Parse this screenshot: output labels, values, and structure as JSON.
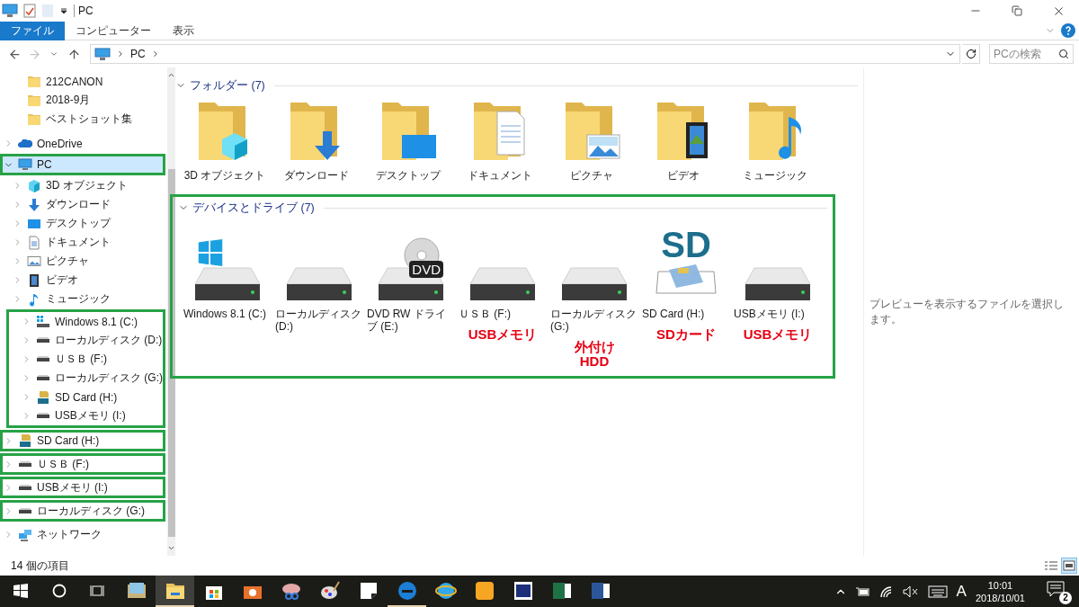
{
  "window": {
    "title": "PC"
  },
  "ribbon": {
    "tabs": [
      {
        "label": "ファイル",
        "selected": true
      },
      {
        "label": "コンピューター",
        "selected": false
      },
      {
        "label": "表示",
        "selected": false
      }
    ]
  },
  "address_bar": {
    "nav": [
      {
        "kind": "back",
        "disabled": false
      },
      {
        "kind": "forward",
        "disabled": true
      },
      {
        "kind": "recent",
        "disabled": false
      },
      {
        "kind": "up",
        "disabled": false
      }
    ],
    "path": [
      "PC"
    ],
    "search": {
      "placeholder": "PCの検索"
    }
  },
  "sidebar": {
    "quick_access_items": [
      {
        "label": "212CANON"
      },
      {
        "label": "2018-9月"
      },
      {
        "label": "ベストショット集"
      }
    ],
    "items": [
      {
        "kind": "cloud",
        "label": "OneDrive",
        "expanded": false,
        "selected": false,
        "framed": false
      },
      {
        "kind": "pc",
        "label": "PC",
        "expanded": true,
        "selected": true,
        "framed": true,
        "children": [
          {
            "kind": "cube",
            "label": "3D オブジェクト",
            "expanded": false,
            "selected": false,
            "framed": false
          },
          {
            "kind": "download",
            "label": "ダウンロード",
            "expanded": false,
            "selected": false,
            "framed": false
          },
          {
            "kind": "desktop",
            "label": "デスクトップ",
            "expanded": false,
            "selected": false,
            "framed": false
          },
          {
            "kind": "document",
            "label": "ドキュメント",
            "expanded": false,
            "selected": false,
            "framed": false
          },
          {
            "kind": "picture",
            "label": "ピクチャ",
            "expanded": false,
            "selected": false,
            "framed": false
          },
          {
            "kind": "video",
            "label": "ビデオ",
            "expanded": false,
            "selected": false,
            "framed": false
          },
          {
            "kind": "music",
            "label": "ミュージック",
            "expanded": false,
            "selected": false,
            "framed": false
          },
          {
            "kind": "frame",
            "items": [
              {
                "kind": "windows-drive",
                "label": "Windows 8.1 (C:)",
                "expanded": false,
                "selected": false,
                "framed": false
              },
              {
                "kind": "drive",
                "label": "ローカルディスク (D:)",
                "expanded": false,
                "selected": false,
                "framed": false
              },
              {
                "kind": "drive",
                "label": "ＵＳＢ (F:)",
                "expanded": false,
                "selected": false,
                "framed": false
              },
              {
                "kind": "drive",
                "label": "ローカルディスク (G:)",
                "expanded": false,
                "selected": false,
                "framed": false
              },
              {
                "kind": "sd",
                "label": "SD Card (H:)",
                "expanded": false,
                "selected": false,
                "framed": false
              },
              {
                "kind": "drive",
                "label": "USBメモリ (I:)",
                "expanded": false,
                "selected": false,
                "framed": false
              }
            ]
          }
        ]
      },
      {
        "kind": "sd",
        "label": "SD Card (H:)",
        "expanded": false,
        "selected": false,
        "framed": true
      },
      {
        "kind": "drive",
        "label": "ＵＳＢ (F:)",
        "expanded": false,
        "selected": false,
        "framed": true
      },
      {
        "kind": "drive",
        "label": "USBメモリ (I:)",
        "expanded": false,
        "selected": false,
        "framed": true
      },
      {
        "kind": "drive",
        "label": "ローカルディスク (G:)",
        "expanded": false,
        "selected": false,
        "framed": true
      },
      {
        "kind": "network",
        "label": "ネットワーク",
        "expanded": false,
        "selected": false,
        "framed": false
      }
    ]
  },
  "content": {
    "sections": [
      {
        "kind": "folders",
        "title": "フォルダー (7)",
        "expanded": true,
        "framed": false,
        "items": [
          {
            "label": "3D オブジェクト",
            "kind": "cube"
          },
          {
            "label": "ダウンロード",
            "kind": "download"
          },
          {
            "label": "デスクトップ",
            "kind": "desktop"
          },
          {
            "label": "ドキュメント",
            "kind": "document"
          },
          {
            "label": "ピクチャ",
            "kind": "picture"
          },
          {
            "label": "ビデオ",
            "kind": "video"
          },
          {
            "label": "ミュージック",
            "kind": "music"
          }
        ]
      },
      {
        "kind": "drives",
        "title": "デバイスとドライブ (7)",
        "expanded": true,
        "framed": true,
        "items": [
          {
            "label": "Windows 8.1 (C:)",
            "kind": "windows-drive"
          },
          {
            "label": "ローカルディスク (D:)",
            "kind": "drive"
          },
          {
            "label": "DVD RW ドライブ (E:)",
            "kind": "dvd",
            "icon_text": "DVD"
          },
          {
            "label": "ＵＳＢ (F:)",
            "kind": "drive",
            "note_lines": [
              "USBメモリ"
            ]
          },
          {
            "label": "ローカルディスク (G:)",
            "kind": "drive",
            "note_lines": [
              "外付け",
              "HDD"
            ]
          },
          {
            "label": "SD Card (H:)",
            "kind": "sd",
            "icon_text": "SD",
            "note_lines": [
              "SDカード"
            ]
          },
          {
            "label": "USBメモリ (I:)",
            "kind": "drive",
            "note_lines": [
              "USBメモリ"
            ]
          }
        ]
      }
    ]
  },
  "preview": {
    "message": "プレビューを表示するファイルを選択します。"
  },
  "status_bar": {
    "count": "14 個の項目",
    "views": [
      {
        "kind": "details",
        "selected": false
      },
      {
        "kind": "large-icons",
        "selected": true
      }
    ]
  },
  "taskbar": {
    "apps": [
      {
        "kind": "photos",
        "active": false,
        "running": false
      },
      {
        "kind": "explorer",
        "active": true,
        "running": true
      },
      {
        "kind": "store",
        "active": false,
        "running": false
      },
      {
        "kind": "camera",
        "active": false,
        "running": false
      },
      {
        "kind": "scissors",
        "active": false,
        "running": false
      },
      {
        "kind": "paint",
        "active": false,
        "running": false
      },
      {
        "kind": "sticky",
        "active": false,
        "running": false
      },
      {
        "kind": "edge",
        "active": false,
        "running": true
      },
      {
        "kind": "ie",
        "active": false,
        "running": false
      },
      {
        "kind": "orange",
        "active": false,
        "running": false
      },
      {
        "kind": "navy",
        "active": false,
        "running": false
      },
      {
        "kind": "excel",
        "active": false,
        "running": false
      },
      {
        "kind": "word",
        "active": false,
        "running": false
      }
    ],
    "tray": {
      "ime": "A",
      "time": "10:01",
      "date": "2018/10/01",
      "notifications": "2"
    }
  }
}
